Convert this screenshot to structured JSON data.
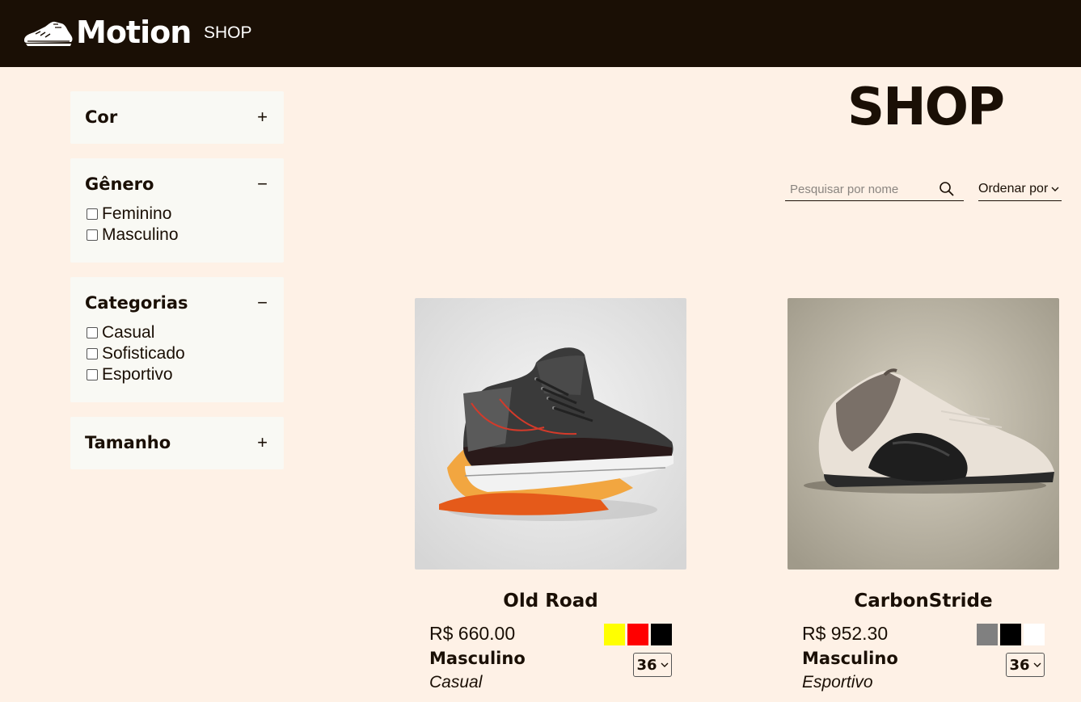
{
  "header": {
    "brand": "Motion",
    "nav_shop": "SHOP",
    "logo_icon": "sneaker-icon",
    "bg_color": "#1a0f05"
  },
  "page": {
    "title": "SHOP",
    "bg_color": "#fef1e6"
  },
  "filters": [
    {
      "title": "Cor",
      "expanded": false,
      "toggle": "+",
      "options": []
    },
    {
      "title": "Gênero",
      "expanded": true,
      "toggle": "−",
      "options": [
        "Feminino",
        "Masculino"
      ]
    },
    {
      "title": "Categorias",
      "expanded": true,
      "toggle": "−",
      "options": [
        "Casual",
        "Sofisticado",
        "Esportivo"
      ]
    },
    {
      "title": "Tamanho",
      "expanded": false,
      "toggle": "+",
      "options": []
    }
  ],
  "search": {
    "placeholder": "Pesquisar por nome",
    "value": "",
    "icon": "search-icon"
  },
  "sort": {
    "label": "Ordenar por",
    "icon": "chevron-down-icon"
  },
  "products": [
    {
      "name": "Old Road",
      "price": "R$ 660.00",
      "gender": "Masculino",
      "category": "Casual",
      "colors": [
        "#ffff00",
        "#ff0000",
        "#000000"
      ],
      "size": "36"
    },
    {
      "name": "CarbonStride",
      "price": "R$ 952.30",
      "gender": "Masculino",
      "category": "Esportivo",
      "colors": [
        "#808080",
        "#000000",
        "#ffffff"
      ],
      "size": "36"
    }
  ]
}
